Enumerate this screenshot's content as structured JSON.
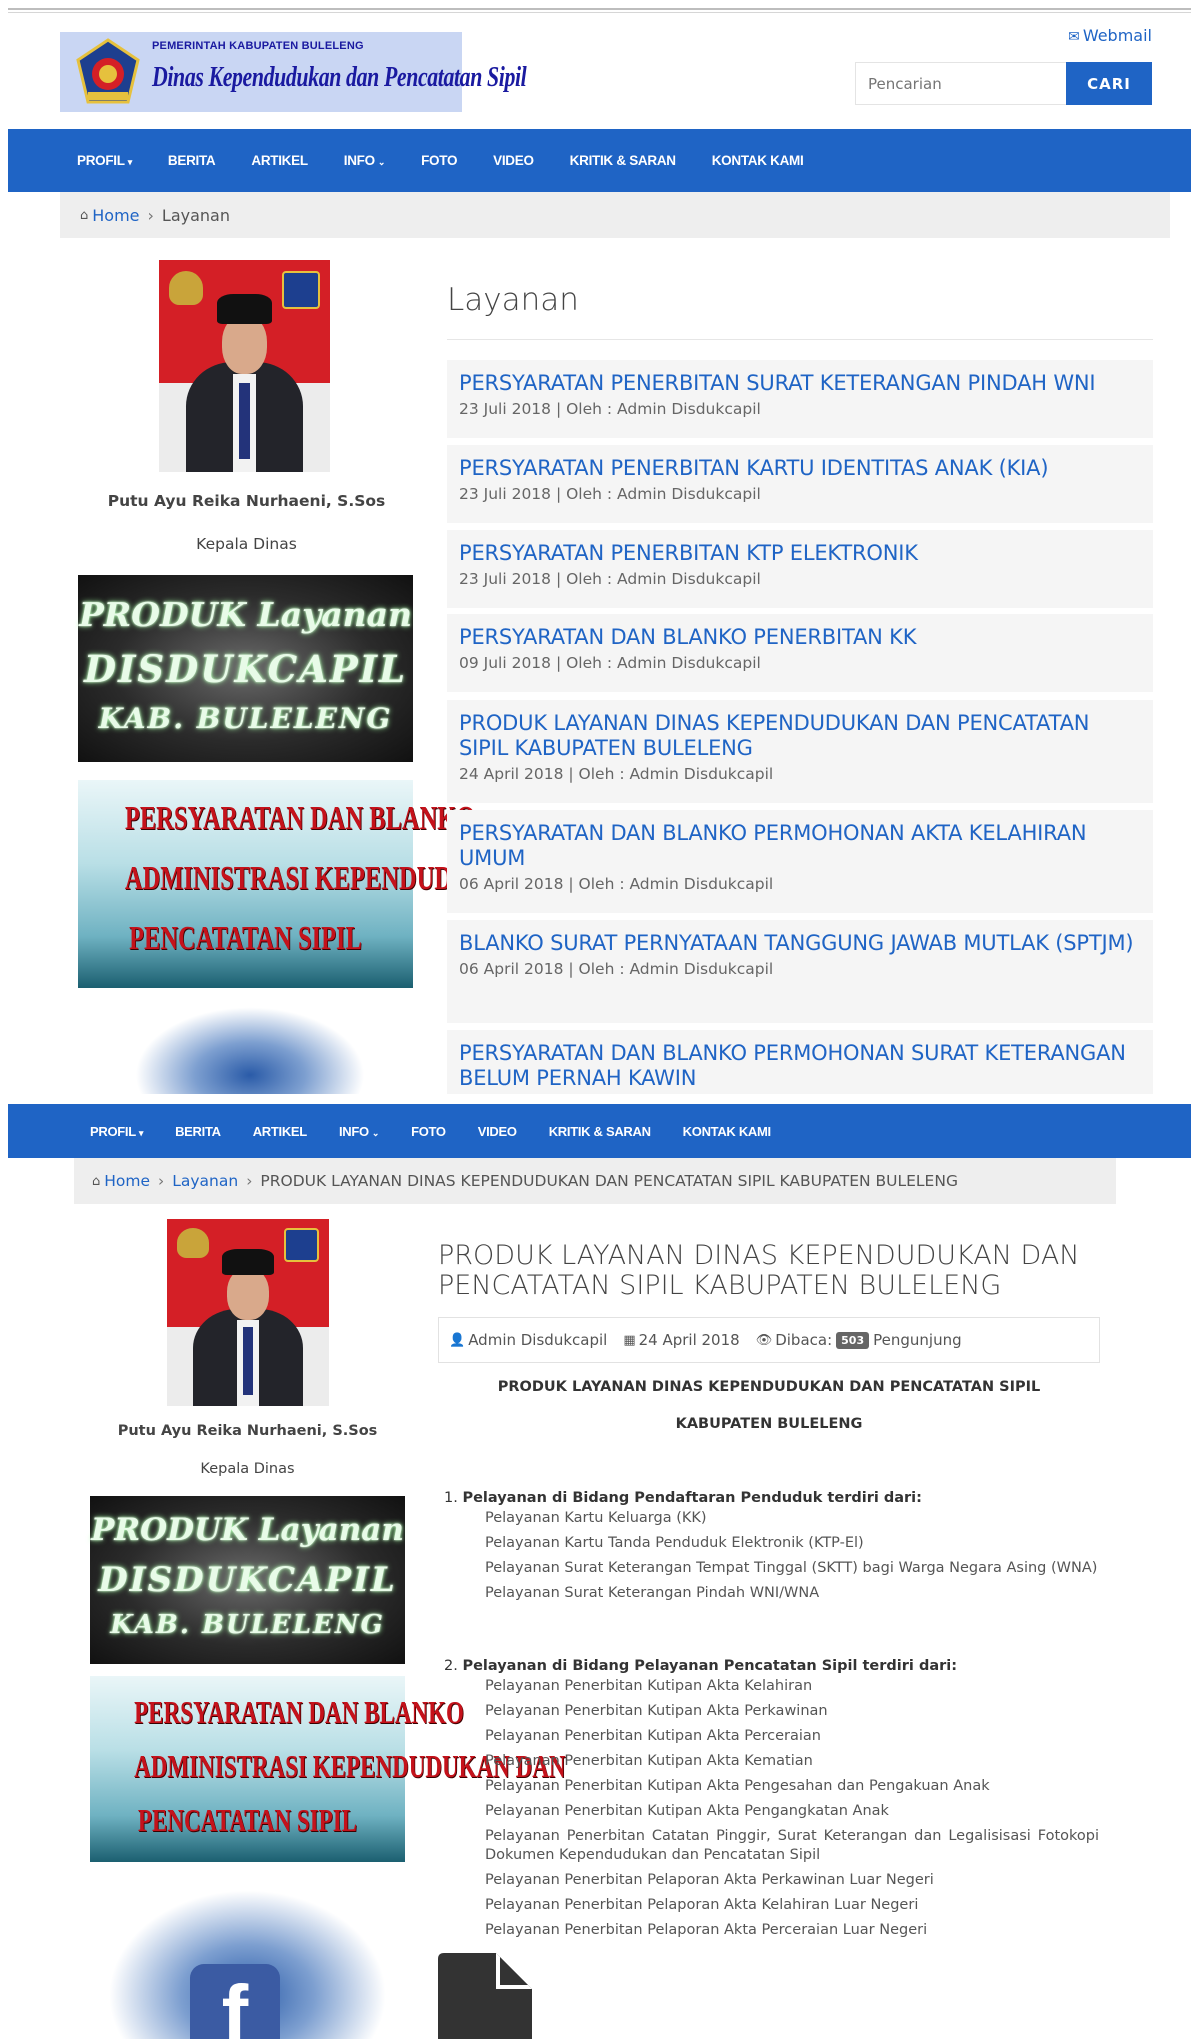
{
  "header": {
    "logo_line1": "PEMERINTAH KABUPATEN BULELENG",
    "logo_line2": "Dinas Kependudukan dan Pencatatan Sipil",
    "webmail": "Webmail",
    "search_placeholder": "Pencarian",
    "search_button": "CARI"
  },
  "nav": {
    "items": [
      {
        "label": "PROFIL",
        "caret": "▾"
      },
      {
        "label": "BERITA",
        "caret": ""
      },
      {
        "label": "ARTIKEL",
        "caret": ""
      },
      {
        "label": "INFO",
        "caret": "⌄"
      },
      {
        "label": "FOTO",
        "caret": ""
      },
      {
        "label": "VIDEO",
        "caret": ""
      },
      {
        "label": "KRITIK & SARAN",
        "caret": ""
      },
      {
        "label": "KONTAK KAMI",
        "caret": ""
      }
    ]
  },
  "breadcrumb1": {
    "home": "Home",
    "current": "Layanan"
  },
  "breadcrumb2": {
    "home": "Home",
    "parent": "Layanan",
    "current": "PRODUK LAYANAN DINAS KEPENDUDUKAN DAN PENCATATAN SIPIL KABUPATEN BULELENG"
  },
  "sidebar": {
    "name": "Putu Ayu Reika Nurhaeni, S.Sos",
    "role": "Kepala Dinas",
    "banner1_lines": [
      "PRODUK Layanan",
      "DISDUKCAPIL",
      "KAB. BULELENG"
    ],
    "banner2_lines": [
      "PERSYARATAN DAN BLANKO",
      "ADMINISTRASI KEPENDUDUKAN DAN",
      "PENCATATAN SIPIL"
    ],
    "facebook_letter": "f"
  },
  "layanan": {
    "title": "Layanan",
    "posts": [
      {
        "title": "PERSYARATAN PENERBITAN SURAT KETERANGAN PINDAH WNI",
        "meta": "23 Juli 2018 | Oleh : Admin Disdukcapil"
      },
      {
        "title": "PERSYARATAN PENERBITAN KARTU IDENTITAS ANAK (KIA)",
        "meta": "23 Juli 2018 | Oleh : Admin Disdukcapil"
      },
      {
        "title": "PERSYARATAN PENERBITAN KTP ELEKTRONIK",
        "meta": "23 Juli 2018 | Oleh : Admin Disdukcapil"
      },
      {
        "title": "PERSYARATAN DAN BLANKO PENERBITAN KK",
        "meta": "09 Juli 2018 | Oleh : Admin Disdukcapil"
      },
      {
        "title": "PRODUK LAYANAN DINAS KEPENDUDUKAN DAN PENCATATAN SIPIL KABUPATEN BULELENG",
        "meta": "24 April 2018 | Oleh : Admin Disdukcapil"
      },
      {
        "title": "PERSYARATAN DAN BLANKO PERMOHONAN AKTA KELAHIRAN UMUM",
        "meta": "06 April 2018 | Oleh : Admin Disdukcapil"
      },
      {
        "title": "BLANKO SURAT PERNYATAAN TANGGUNG JAWAB MUTLAK (SPTJM)",
        "meta": "06 April 2018 | Oleh : Admin Disdukcapil"
      },
      {
        "title": "PERSYARATAN DAN BLANKO PERMOHONAN SURAT KETERANGAN BELUM PERNAH KAWIN",
        "meta": ""
      }
    ]
  },
  "article": {
    "title": "PRODUK LAYANAN DINAS KEPENDUDUKAN DAN PENCATATAN SIPIL KABUPATEN BULELENG",
    "author": "Admin Disdukcapil",
    "date": "24 April 2018",
    "views_label": "Dibaca:",
    "views_count": "503",
    "views_suffix": "Pengunjung",
    "heading1": "PRODUK LAYANAN DINAS KEPENDUDUKAN DAN PENCATATAN SIPIL",
    "heading2": "KABUPATEN BULELENG",
    "section1_num": "1.",
    "section1_title": "Pelayanan di Bidang Pendaftaran Penduduk terdiri dari:",
    "section1_items": [
      "Pelayanan Kartu Keluarga (KK)",
      "Pelayanan Kartu Tanda Penduduk Elektronik (KTP-El)",
      "Pelayanan Surat Keterangan Tempat Tinggal (SKTT) bagi Warga Negara Asing (WNA)",
      "Pelayanan Surat Keterangan Pindah WNI/WNA"
    ],
    "section2_num": "2.",
    "section2_title": "Pelayanan di Bidang Pelayanan Pencatatan Sipil terdiri dari:",
    "section2_items": [
      "Pelayanan Penerbitan Kutipan Akta Kelahiran",
      "Pelayanan Penerbitan Kutipan Akta Perkawinan",
      "Pelayanan Penerbitan Kutipan Akta Perceraian",
      "Pelayanan Penerbitan Kutipan Akta Kematian",
      "Pelayanan Penerbitan Kutipan Akta Pengesahan dan Pengakuan Anak",
      "Pelayanan Penerbitan Kutipan Akta Pengangkatan Anak",
      "Pelayanan Penerbitan Catatan Pinggir, Surat Keterangan dan Legalisisasi Fotokopi Dokumen Kependudukan dan Pencatatan Sipil",
      "Pelayanan Penerbitan Pelaporan Akta Perkawinan Luar Negeri",
      "Pelayanan Penerbitan Pelaporan Akta Kelahiran Luar Negeri",
      "Pelayanan Penerbitan Pelaporan Akta Perceraian Luar Negeri"
    ]
  },
  "colors": {
    "primary": "#1f64c5",
    "breadcrumb_bg": "#eeeeee",
    "post_bg": "#f5f5f5",
    "banner_red": "#c5121b"
  }
}
